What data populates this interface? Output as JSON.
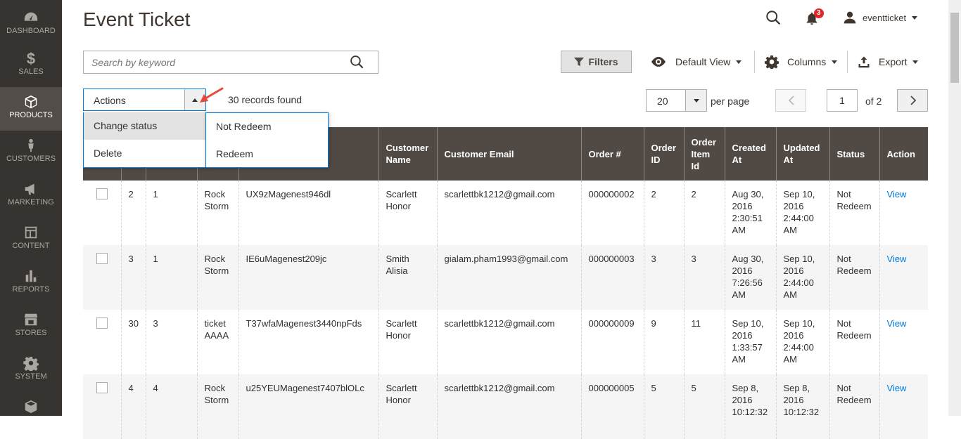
{
  "sidebar": {
    "items": [
      {
        "label": "DASHBOARD",
        "icon": "dashboard-icon"
      },
      {
        "label": "SALES",
        "icon": "dollar-icon"
      },
      {
        "label": "PRODUCTS",
        "icon": "cube-icon"
      },
      {
        "label": "CUSTOMERS",
        "icon": "person-icon"
      },
      {
        "label": "MARKETING",
        "icon": "megaphone-icon"
      },
      {
        "label": "CONTENT",
        "icon": "layout-icon"
      },
      {
        "label": "REPORTS",
        "icon": "bar-chart-icon"
      },
      {
        "label": "STORES",
        "icon": "storefront-icon"
      },
      {
        "label": "SYSTEM",
        "icon": "gear-icon"
      }
    ],
    "active": "PRODUCTS"
  },
  "header": {
    "title": "Event Ticket",
    "notifications_count": "3",
    "username": "eventticket"
  },
  "toolbar": {
    "search_placeholder": "Search by keyword",
    "filters_label": "Filters",
    "view_label": "Default View",
    "columns_label": "Columns",
    "export_label": "Export"
  },
  "actions": {
    "label": "Actions",
    "records_found": "30 records found",
    "menu": [
      "Change status",
      "Delete"
    ],
    "submenu": [
      "Not Redeem",
      "Redeem"
    ]
  },
  "pagination": {
    "per_page": "20",
    "per_page_label": "per page",
    "current_page": "1",
    "of_label": "of 2"
  },
  "table": {
    "columns": [
      "",
      "",
      "",
      "",
      "",
      "Customer Name",
      "Customer Email",
      "Order #",
      "Order ID",
      "Order Item Id",
      "Created At",
      "Updated At",
      "Status",
      "Action"
    ],
    "rows": [
      {
        "id": "2",
        "event": "1",
        "ticket": "Rock Storm",
        "code": "UX9zMagenest946dl",
        "name": "Scarlett Honor",
        "email": "scarlettbk1212@gmail.com",
        "order_no": "000000002",
        "order_id": "2",
        "item_id": "2",
        "created": "Aug 30, 2016 2:30:51 AM",
        "updated": "Sep 10, 2016 2:44:00 AM",
        "status": "Not Redeem",
        "action": "View"
      },
      {
        "id": "3",
        "event": "1",
        "ticket": "Rock Storm",
        "code": "IE6uMagenest209jc",
        "name": "Smith Alisia",
        "email": "gialam.pham1993@gmail.com",
        "order_no": "000000003",
        "order_id": "3",
        "item_id": "3",
        "created": "Aug 30, 2016 7:26:56 AM",
        "updated": "Sep 10, 2016 2:44:00 AM",
        "status": "Not Redeem",
        "action": "View"
      },
      {
        "id": "30",
        "event": "3",
        "ticket": "ticket AAAA",
        "code": "T37wfaMagenest3440npFds",
        "name": "Scarlett Honor",
        "email": "scarlettbk1212@gmail.com",
        "order_no": "000000009",
        "order_id": "9",
        "item_id": "11",
        "created": "Sep 10, 2016 1:33:57 AM",
        "updated": "Sep 10, 2016 2:44:00 AM",
        "status": "Not Redeem",
        "action": "View"
      },
      {
        "id": "4",
        "event": "4",
        "ticket": "Rock Storm",
        "code": "u25YEUMagenest7407blOLc",
        "name": "Scarlett Honor",
        "email": "scarlettbk1212@gmail.com",
        "order_no": "000000005",
        "order_id": "5",
        "item_id": "5",
        "created": "Sep 8, 2016 10:12:32",
        "updated": "Sep 8, 2016 10:12:32",
        "status": "Not Redeem",
        "action": "View"
      }
    ]
  }
}
